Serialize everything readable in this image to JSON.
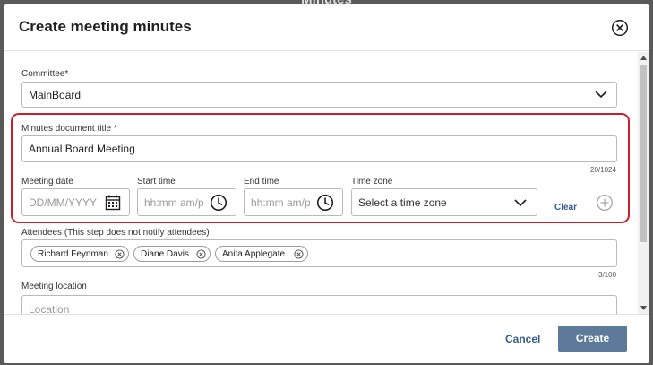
{
  "backdrop": {
    "title": "Minutes"
  },
  "modal": {
    "title": "Create meeting minutes",
    "close_icon": "close-circle-icon"
  },
  "form": {
    "committee": {
      "label": "Committee*",
      "value": "MainBoard"
    },
    "doc_title": {
      "label": "Minutes document title *",
      "value": "Annual Board Meeting",
      "counter": "20/1024"
    },
    "meeting_date": {
      "label": "Meeting date",
      "placeholder": "DD/MM/YYYY",
      "icon": "calendar-icon"
    },
    "start_time": {
      "label": "Start time",
      "placeholder": "hh:mm am/p",
      "icon": "clock-icon"
    },
    "end_time": {
      "label": "End time",
      "placeholder": "hh:mm am/p",
      "icon": "clock-icon"
    },
    "time_zone": {
      "label": "Time zone",
      "placeholder": "Select a time zone",
      "clear_label": "Clear",
      "add_icon": "plus-circle-icon"
    },
    "attendees": {
      "label": "Attendees (This step does not notify attendees)",
      "chips": [
        "Richard Feynman",
        "Diane Davis",
        "Anita Applegate"
      ],
      "counter": "3/100"
    },
    "location": {
      "label": "Meeting location",
      "placeholder": "Location"
    }
  },
  "footer": {
    "cancel_label": "Cancel",
    "create_label": "Create"
  },
  "colors": {
    "highlight": "#c8202e",
    "primary": "#5e7a9b",
    "link": "#355d8c"
  }
}
